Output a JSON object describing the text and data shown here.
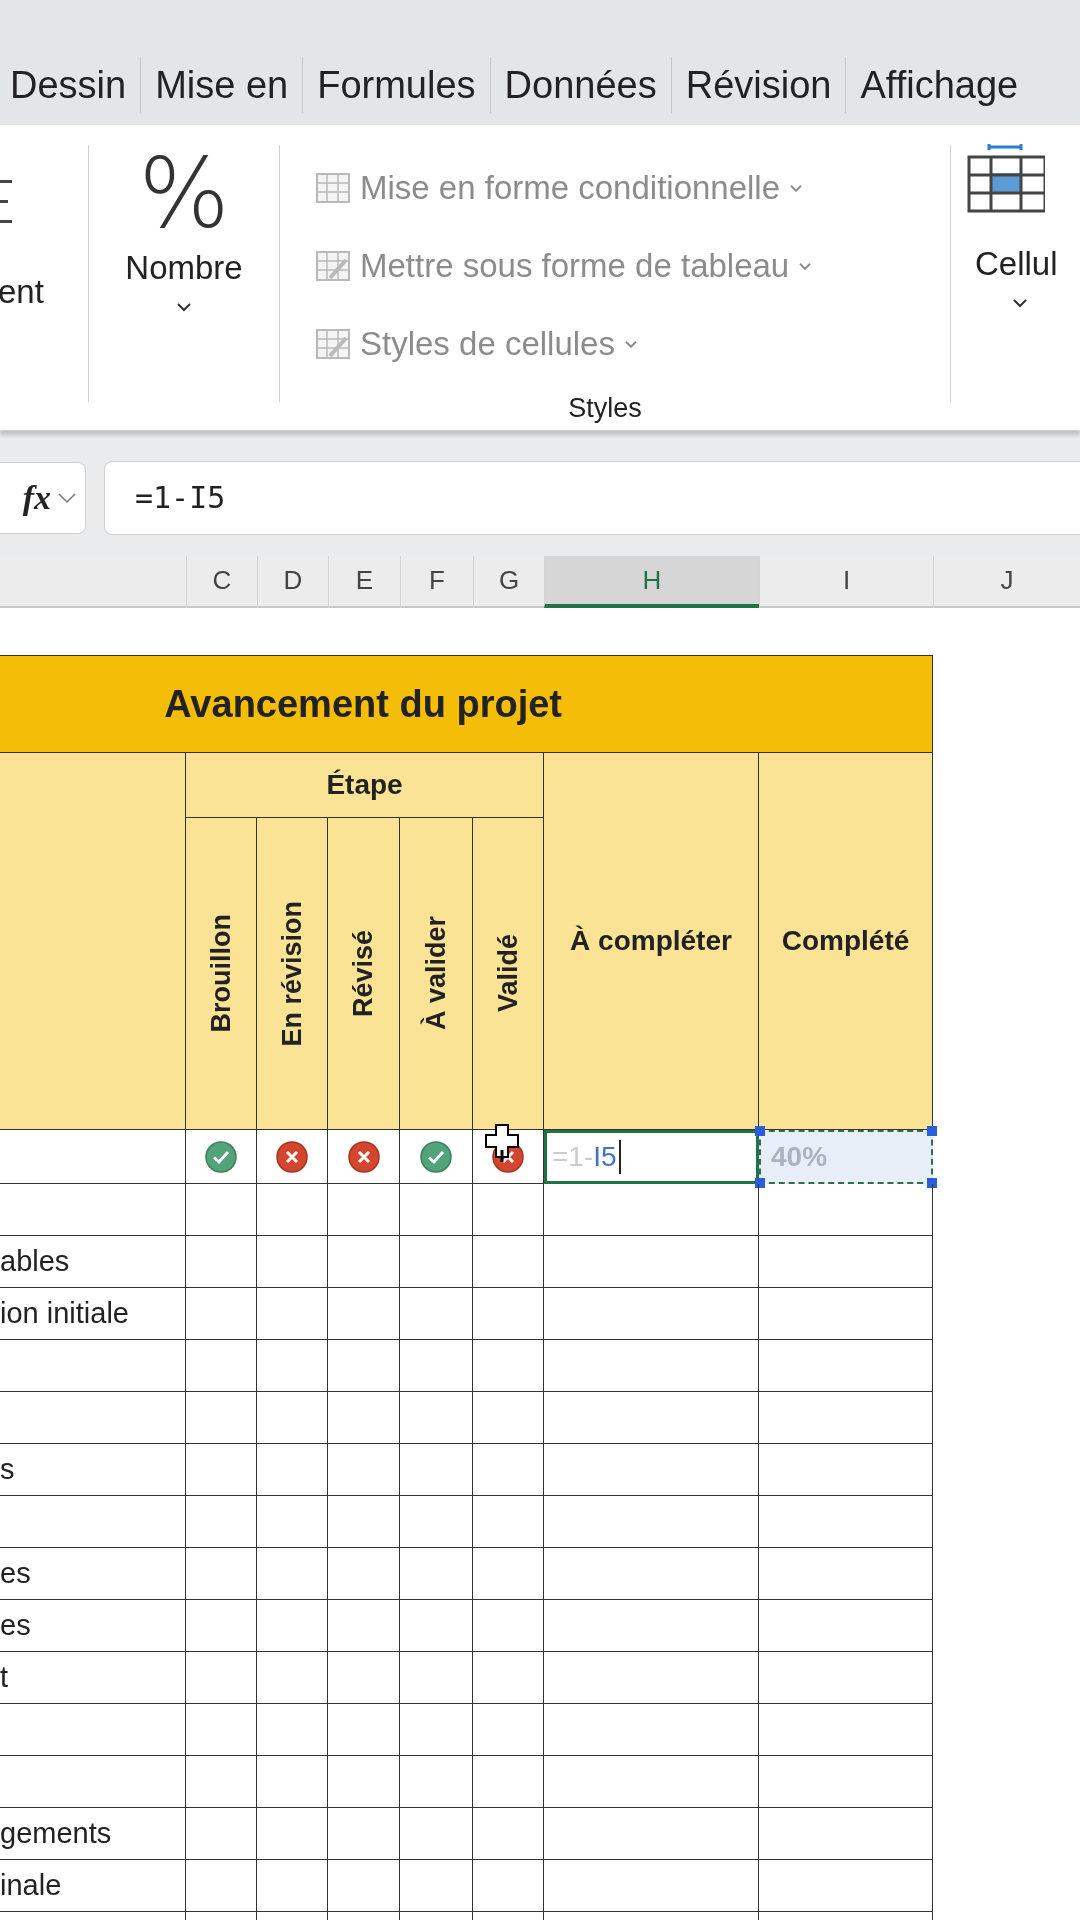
{
  "ribbon_tabs": [
    "Dessin",
    "Mise en",
    "Formules",
    "Données",
    "Révision",
    "Affichage"
  ],
  "ribbon": {
    "groups": [
      {
        "kind": "partial",
        "label": "ent"
      },
      {
        "kind": "number",
        "symbol": "%",
        "label": "Nombre"
      },
      {
        "kind": "styles",
        "label": "Styles",
        "items": [
          {
            "label": "Mise en forme conditionnelle",
            "disabled": true
          },
          {
            "label": "Mettre sous forme de tableau",
            "disabled": true
          },
          {
            "label": "Styles de cellules",
            "disabled": true
          }
        ]
      },
      {
        "kind": "cells",
        "label": "Cellul"
      }
    ]
  },
  "formula_bar": {
    "fx": "fx",
    "value": "=1-I5"
  },
  "column_headers": [
    {
      "label": "C",
      "selected": false
    },
    {
      "label": "D",
      "selected": false
    },
    {
      "label": "E",
      "selected": false
    },
    {
      "label": "F",
      "selected": false
    },
    {
      "label": "G",
      "selected": false
    },
    {
      "label": "H",
      "selected": true
    },
    {
      "label": "I",
      "selected": false
    },
    {
      "label": "J",
      "selected": false
    }
  ],
  "table": {
    "title": "Avancement du projet",
    "group_header": "Étape",
    "stage_columns": [
      "Brouillon",
      "En révision",
      "Révisé",
      "À valider",
      "Validé"
    ],
    "columns": [
      "À compléter",
      "Complété"
    ],
    "first_row": {
      "stages": [
        {
          "done": true
        },
        {
          "done": false
        },
        {
          "done": false
        },
        {
          "done": true
        },
        {
          "done": false
        }
      ],
      "editing": {
        "prefix": "=1-",
        "reference": "I5"
      },
      "copied_value": "40%"
    },
    "rows": [
      {},
      {
        "label": "ables"
      },
      {
        "label": "ion initiale"
      },
      {},
      {},
      {
        "label": "s"
      },
      {},
      {
        "label": "es"
      },
      {
        "label": "es"
      },
      {
        "label": "t"
      },
      {},
      {},
      {
        "label": "gements"
      },
      {
        "label": "inale"
      },
      {}
    ]
  }
}
